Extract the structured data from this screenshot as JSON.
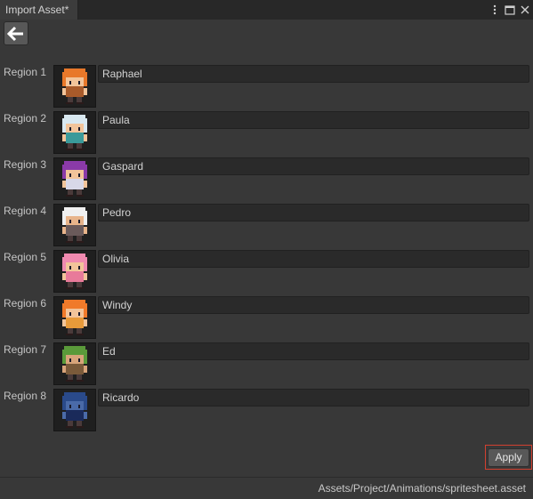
{
  "window": {
    "tab_title": "Import Asset*"
  },
  "title_icons": [
    "more-vert-icon",
    "maximize-icon",
    "close-icon"
  ],
  "back_button": {
    "icon": "arrow-left-icon"
  },
  "regions": [
    {
      "label": "Region 1",
      "name": "Raphael",
      "hair": "#e8782a",
      "skin": "#f2c49a",
      "outfit": "#a85a2a"
    },
    {
      "label": "Region 2",
      "name": "Paula",
      "hair": "#d8e8f0",
      "skin": "#f2c49a",
      "outfit": "#3a9a9a"
    },
    {
      "label": "Region 3",
      "name": "Gaspard",
      "hair": "#8a3aa8",
      "skin": "#f2c49a",
      "outfit": "#d8d8e8"
    },
    {
      "label": "Region 4",
      "name": "Pedro",
      "hair": "#f0f0f0",
      "skin": "#e8b48a",
      "outfit": "#6a5a5a"
    },
    {
      "label": "Region 5",
      "name": "Olivia",
      "hair": "#f08ab0",
      "skin": "#f2c49a",
      "outfit": "#e87a9a"
    },
    {
      "label": "Region 6",
      "name": "Windy",
      "hair": "#f07a2a",
      "skin": "#f2c49a",
      "outfit": "#e89a3a"
    },
    {
      "label": "Region 7",
      "name": "Ed",
      "hair": "#5a9a3a",
      "skin": "#d8a47a",
      "outfit": "#7a5a3a"
    },
    {
      "label": "Region 8",
      "name": "Ricardo",
      "hair": "#2a4a8a",
      "skin": "#4a6aa8",
      "outfit": "#1a2a5a"
    }
  ],
  "apply_button": {
    "label": "Apply",
    "highlight": "#d24030"
  },
  "status_path": "Assets/Project/Animations/spritesheet.asset"
}
